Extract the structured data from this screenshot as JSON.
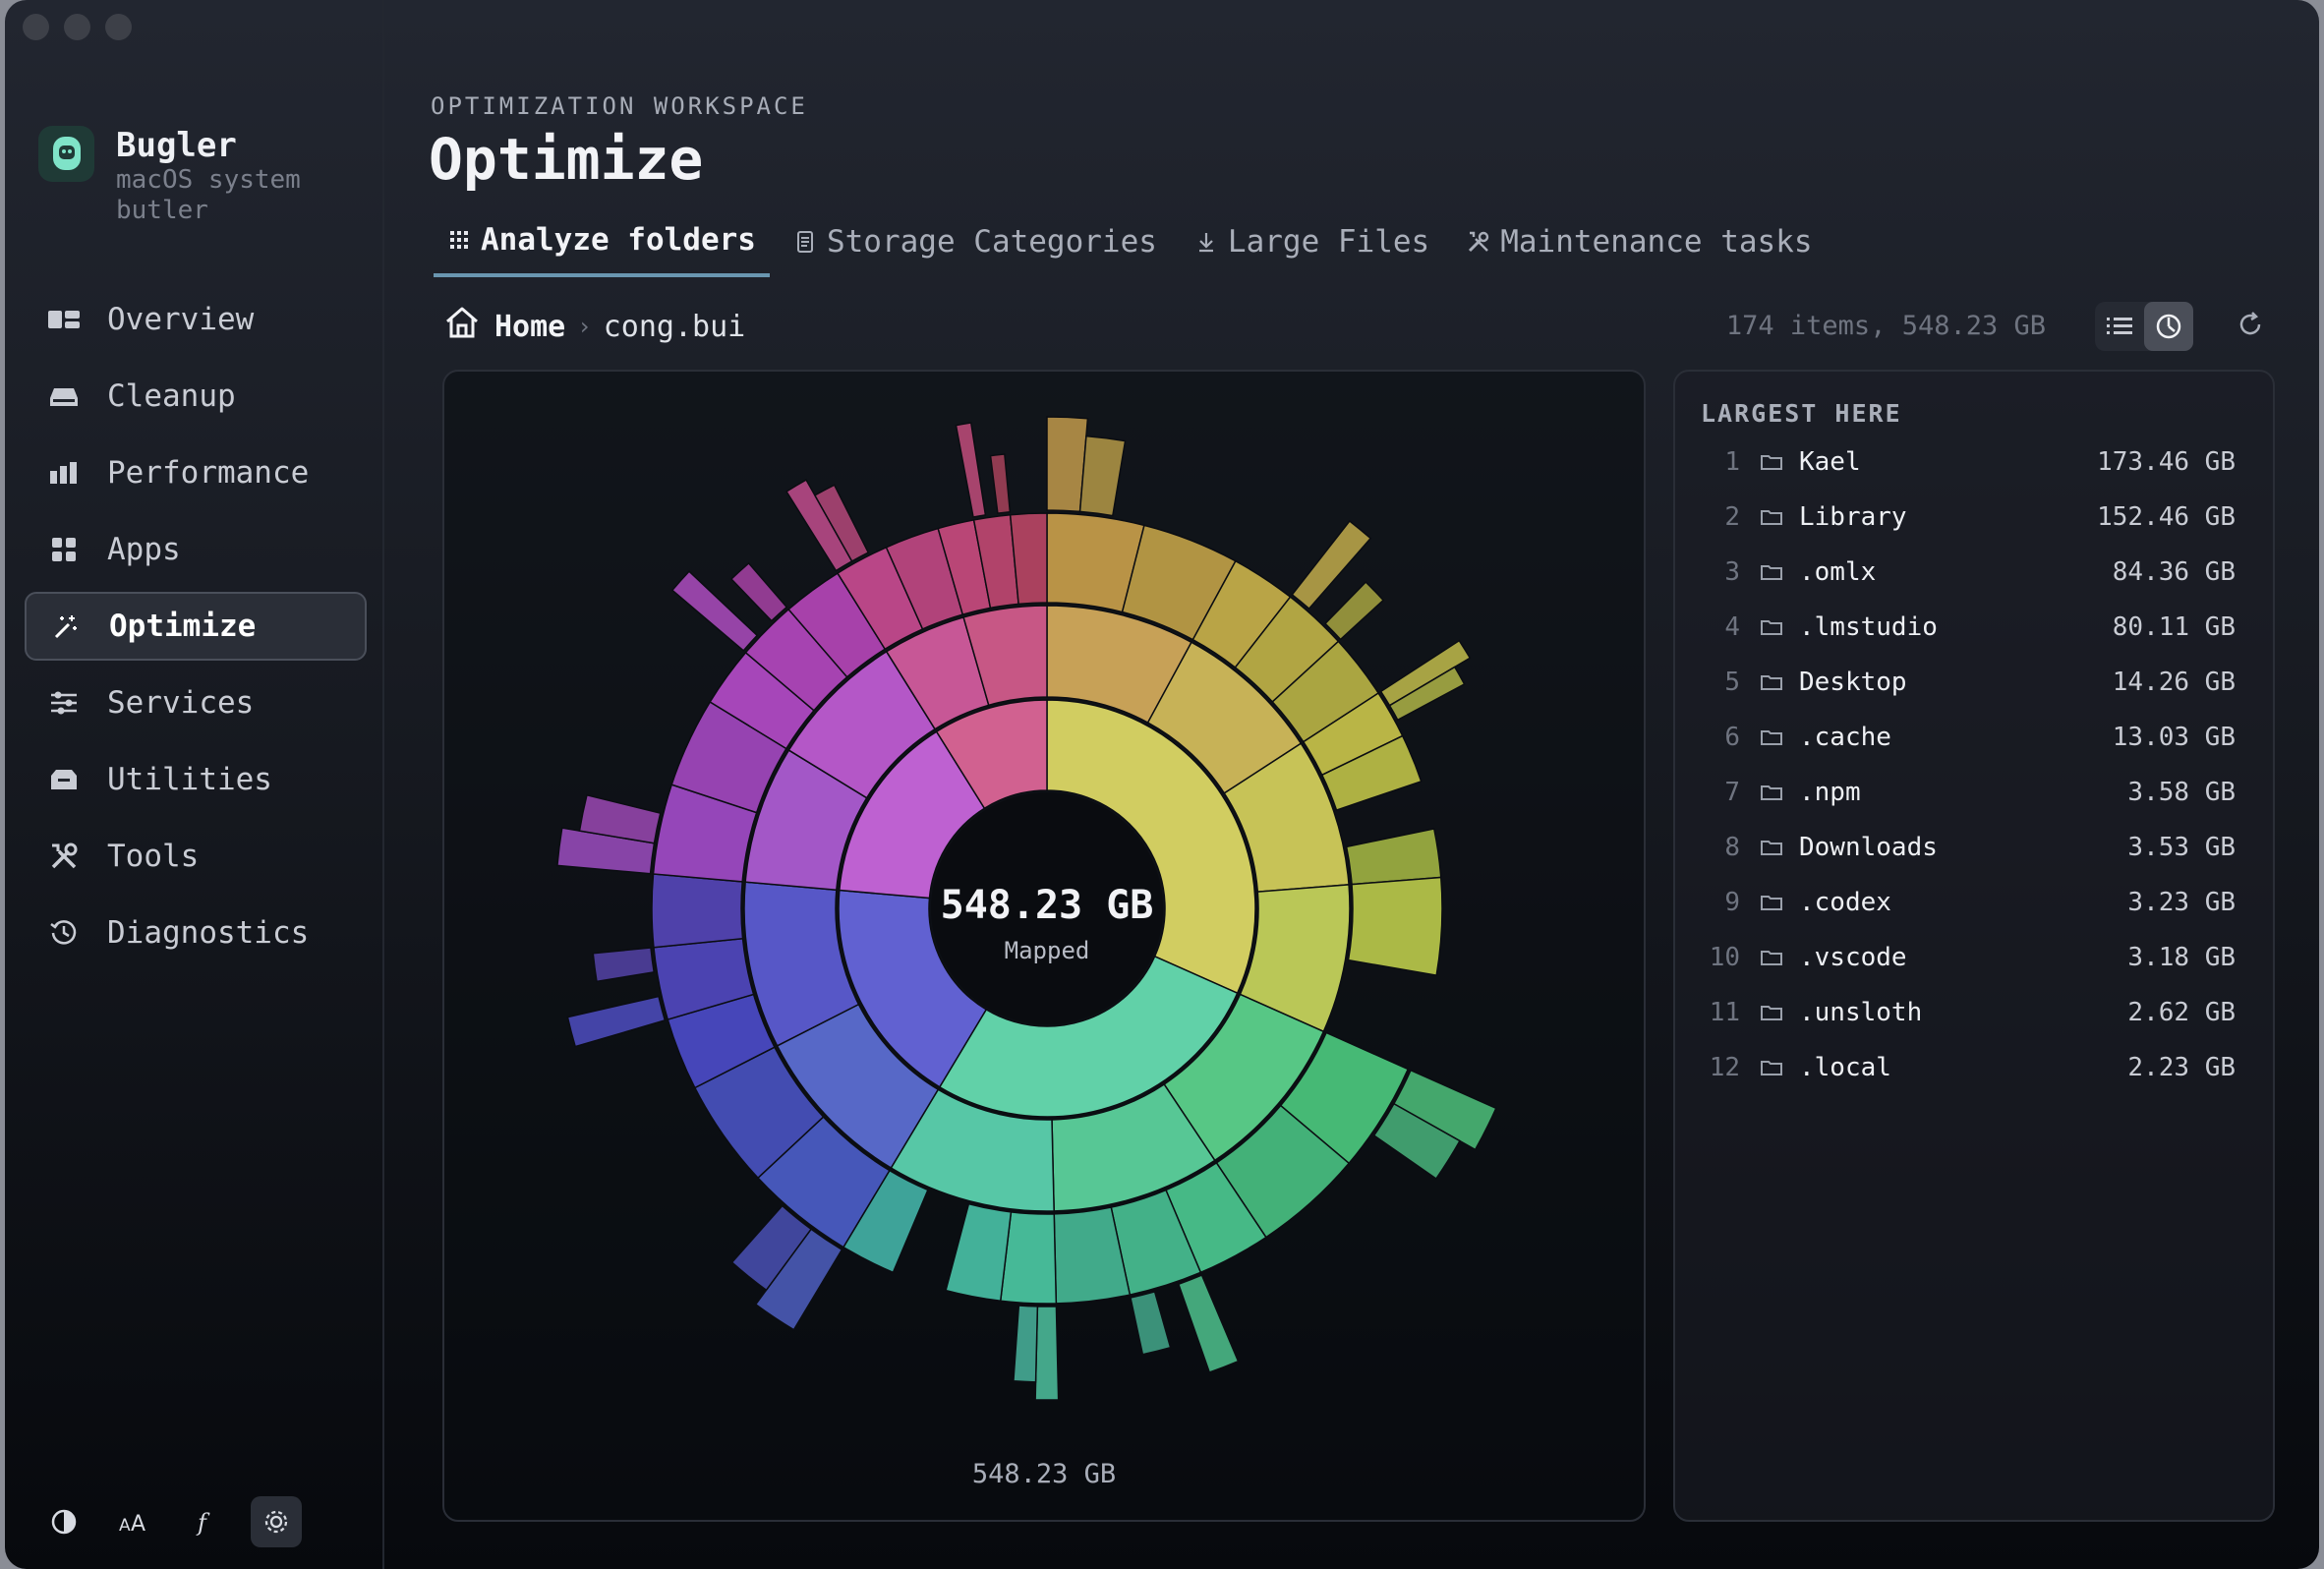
{
  "brand": {
    "name": "Bugler",
    "subtitle": "macOS system butler"
  },
  "nav": [
    {
      "label": "Overview",
      "icon": "overview-icon",
      "active": false
    },
    {
      "label": "Cleanup",
      "icon": "cleanup-icon",
      "active": false
    },
    {
      "label": "Performance",
      "icon": "performance-icon",
      "active": false
    },
    {
      "label": "Apps",
      "icon": "apps-icon",
      "active": false
    },
    {
      "label": "Optimize",
      "icon": "optimize-icon",
      "active": true
    },
    {
      "label": "Services",
      "icon": "services-icon",
      "active": false
    },
    {
      "label": "Utilities",
      "icon": "utilities-icon",
      "active": false
    },
    {
      "label": "Tools",
      "icon": "tools-icon",
      "active": false
    },
    {
      "label": "Diagnostics",
      "icon": "diagnostics-icon",
      "active": false
    }
  ],
  "footer_icons": [
    "contrast-icon",
    "text-size-icon",
    "font-icon",
    "settings-icon"
  ],
  "header": {
    "eyebrow": "OPTIMIZATION WORKSPACE",
    "title": "Optimize"
  },
  "tabs": [
    {
      "label": "Analyze folders",
      "icon": "grid-icon",
      "active": true
    },
    {
      "label": "Storage Categories",
      "icon": "document-icon",
      "active": false
    },
    {
      "label": "Large Files",
      "icon": "download-icon",
      "active": false
    },
    {
      "label": "Maintenance tasks",
      "icon": "wrench-icon",
      "active": false
    }
  ],
  "breadcrumb": {
    "home": "Home",
    "current": "cong.bui"
  },
  "summary": "174 items, 548.23 GB",
  "view_mode": "sunburst",
  "chart": {
    "center_value": "548.23 GB",
    "center_label": "Mapped",
    "total": "548.23 GB"
  },
  "largest": {
    "title": "LARGEST HERE",
    "items": [
      {
        "rank": "1",
        "name": "Kael",
        "size": "173.46 GB"
      },
      {
        "rank": "2",
        "name": "Library",
        "size": "152.46 GB"
      },
      {
        "rank": "3",
        "name": ".omlx",
        "size": "84.36 GB"
      },
      {
        "rank": "4",
        "name": ".lmstudio",
        "size": "80.11 GB"
      },
      {
        "rank": "5",
        "name": "Desktop",
        "size": "14.26 GB"
      },
      {
        "rank": "6",
        "name": ".cache",
        "size": "13.03 GB"
      },
      {
        "rank": "7",
        "name": ".npm",
        "size": "3.58 GB"
      },
      {
        "rank": "8",
        "name": "Downloads",
        "size": "3.53 GB"
      },
      {
        "rank": "9",
        "name": ".codex",
        "size": "3.23 GB"
      },
      {
        "rank": "10",
        "name": ".vscode",
        "size": "3.18 GB"
      },
      {
        "rank": "11",
        "name": ".unsloth",
        "size": "2.62 GB"
      },
      {
        "rank": "12",
        "name": ".local",
        "size": "2.23 GB"
      }
    ]
  },
  "colors": {
    "accent": "#6a96b0",
    "background": "#0c0f14",
    "active_nav": "#2a2e37"
  }
}
